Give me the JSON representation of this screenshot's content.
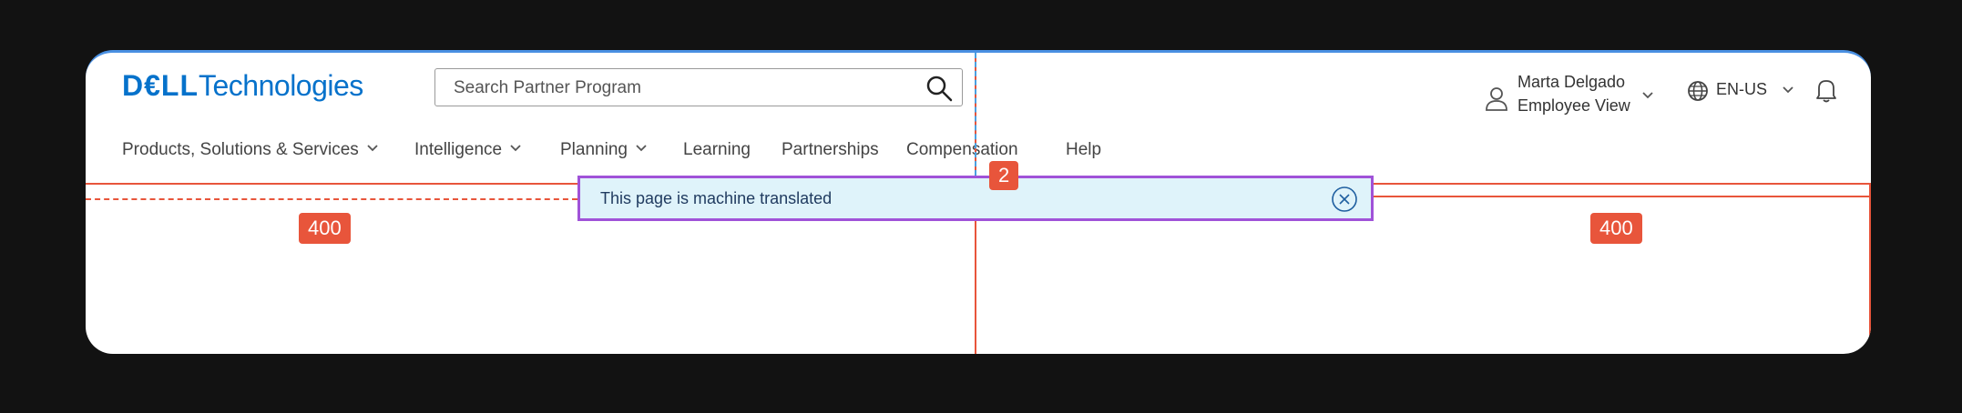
{
  "logo": {
    "brand_bold": "D€LL",
    "brand_rest": "Technologies"
  },
  "search": {
    "placeholder": "Search Partner Program",
    "icon": "search-icon"
  },
  "user": {
    "name": "Marta Delgado",
    "view": "Employee View"
  },
  "language": {
    "code": "EN-US"
  },
  "nav": [
    {
      "label": "Products, Solutions & Services",
      "has_dropdown": true
    },
    {
      "label": "Intelligence",
      "has_dropdown": true
    },
    {
      "label": "Planning",
      "has_dropdown": true
    },
    {
      "label": "Learning",
      "has_dropdown": false
    },
    {
      "label": "Partnerships",
      "has_dropdown": false
    },
    {
      "label": "Compensation",
      "has_dropdown": false
    },
    {
      "label": "Help",
      "has_dropdown": false
    }
  ],
  "banner": {
    "message": "This page is machine translated"
  },
  "annotations": {
    "left_spacing": "400",
    "right_spacing": "400",
    "marker": "2"
  },
  "colors": {
    "brand": "#0672cb",
    "guide": "#e8553b",
    "banner_bg": "#dff3fa",
    "banner_border": "#a052d8"
  }
}
